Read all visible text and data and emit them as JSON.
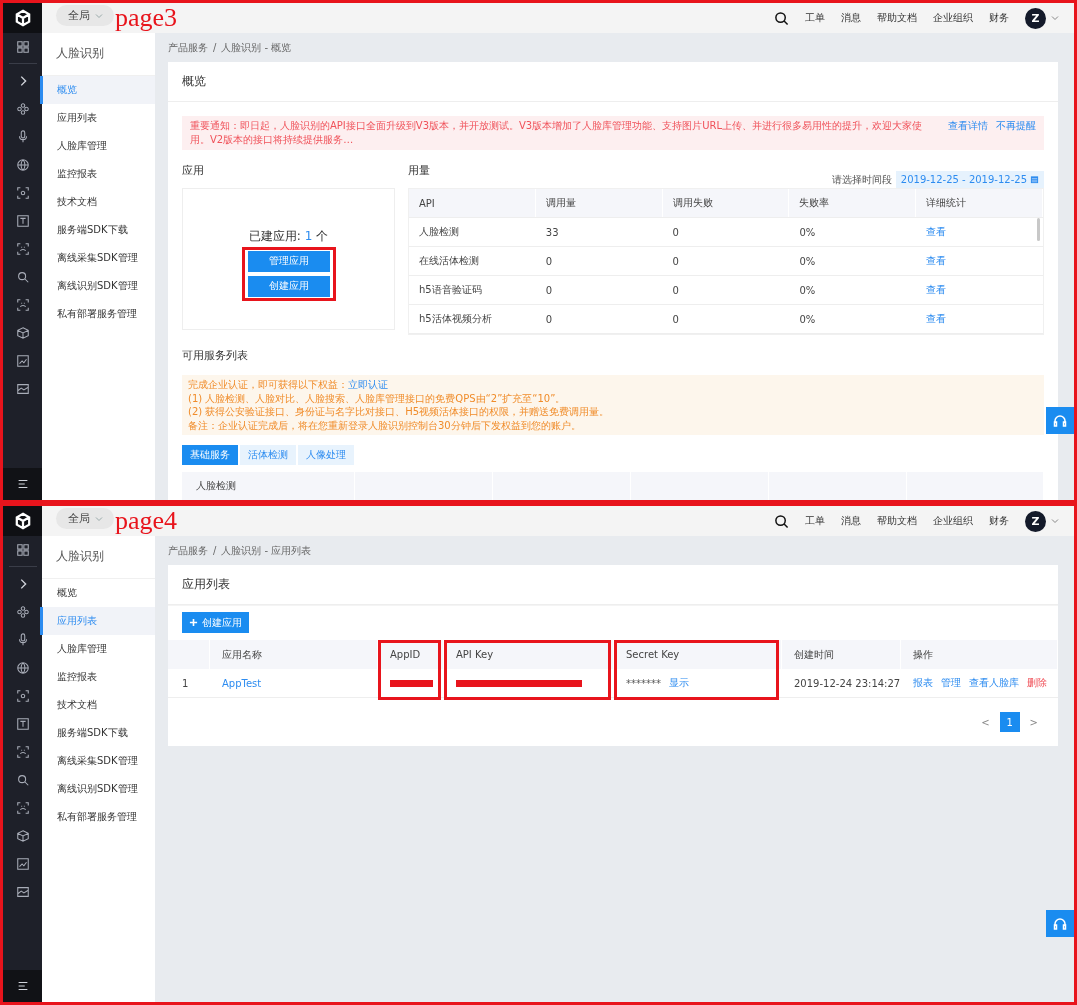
{
  "panes": [
    {
      "annotation": "page3",
      "kind": "overview",
      "topbar": {
        "scope": "全局",
        "links": [
          "工单",
          "消息",
          "帮助文档",
          "企业组织",
          "财务"
        ],
        "avatar": "Z"
      },
      "sidebar": {
        "title": "人脸识别",
        "items": [
          {
            "label": "概览",
            "selected": true
          },
          {
            "label": "应用列表",
            "selected": false
          },
          {
            "label": "人脸库管理",
            "selected": false
          },
          {
            "label": "监控报表",
            "selected": false
          },
          {
            "label": "技术文档",
            "selected": false
          },
          {
            "label": "服务端SDK下载",
            "selected": false
          },
          {
            "label": "离线采集SDK管理",
            "selected": false
          },
          {
            "label": "离线识别SDK管理",
            "selected": false
          },
          {
            "label": "私有部署服务管理",
            "selected": false
          }
        ]
      },
      "breadcrumb": {
        "items": [
          "产品服务",
          "人脸识别 - 概览"
        ],
        "separator": "/"
      },
      "card": {
        "title": "概览",
        "notice": {
          "text": "重要通知：即日起，人脸识别的API接口全面升级到V3版本，并开放测试。V3版本增加了人脸库管理功能、支持图片URL上传、并进行很多易用性的提升，欢迎大家使用。V2版本的接口将持续提供服务…",
          "links": [
            "查看详情",
            "不再提醒"
          ]
        },
        "apps": {
          "title": "应用",
          "label": "已建应用:",
          "count": "1",
          "unit": "个",
          "buttons": [
            "管理应用",
            "创建应用"
          ],
          "annotated": true
        },
        "usage": {
          "title": "用量",
          "date_label": "请选择时间段",
          "date_range": "2019-12-25 - 2019-12-25",
          "columns": [
            "API",
            "调用量",
            "调用失败",
            "失败率",
            "详细统计"
          ],
          "rows": [
            [
              "人脸检测",
              "33",
              "0",
              "0%",
              "查看"
            ],
            [
              "在线活体检测",
              "0",
              "0",
              "0%",
              "查看"
            ],
            [
              "h5语音验证码",
              "0",
              "0",
              "0%",
              "查看"
            ],
            [
              "h5活体视频分析",
              "0",
              "0",
              "0%",
              "查看"
            ]
          ]
        },
        "services": {
          "title": "可用服务列表",
          "banner": {
            "lead": "完成企业认证，即可获得以下权益：",
            "link": "立即认证",
            "lines": [
              "(1) 人脸检测、人脸对比、人脸搜索、人脸库管理接口的免费QPS由“2”扩充至“10”。",
              "(2) 获得公安验证接口、身份证与名字比对接口、H5视频活体接口的权限，并赠送免费调用量。",
              "备注：企业认证完成后，将在您重新登录人脸识别控制台30分钟后下发权益到您的账户。"
            ]
          },
          "tabs": [
            {
              "label": "基础服务",
              "selected": true
            },
            {
              "label": "活体检测",
              "selected": false
            },
            {
              "label": "人像处理",
              "selected": false
            }
          ],
          "table_header": "人脸检测"
        }
      }
    },
    {
      "annotation": "page4",
      "kind": "app_list",
      "topbar": {
        "scope": "全局",
        "links": [
          "工单",
          "消息",
          "帮助文档",
          "企业组织",
          "财务"
        ],
        "avatar": "Z"
      },
      "sidebar": {
        "title": "人脸识别",
        "items": [
          {
            "label": "概览",
            "selected": false
          },
          {
            "label": "应用列表",
            "selected": true
          },
          {
            "label": "人脸库管理",
            "selected": false
          },
          {
            "label": "监控报表",
            "selected": false
          },
          {
            "label": "技术文档",
            "selected": false
          },
          {
            "label": "服务端SDK下载",
            "selected": false
          },
          {
            "label": "离线采集SDK管理",
            "selected": false
          },
          {
            "label": "离线识别SDK管理",
            "selected": false
          },
          {
            "label": "私有部署服务管理",
            "selected": false
          }
        ]
      },
      "breadcrumb": {
        "items": [
          "产品服务",
          "人脸识别 - 应用列表"
        ],
        "separator": "/"
      },
      "card": {
        "title": "应用列表",
        "create_button": "创建应用",
        "columns": [
          {},
          {
            "label": "应用名称"
          },
          {
            "label": "AppID",
            "annotated": true
          },
          {
            "label": "API Key",
            "annotated": true
          },
          {
            "label": "Secret Key",
            "annotated": true
          },
          {
            "label": "创建时间"
          },
          {
            "label": "操作"
          }
        ],
        "rows": [
          [
            {
              "kind": "text",
              "text": "1"
            },
            {
              "kind": "link",
              "text": "AppTest"
            },
            {
              "kind": "redacted"
            },
            {
              "kind": "redacted"
            },
            {
              "kind": "secret",
              "text": "*******",
              "action": "显示"
            },
            {
              "kind": "text",
              "text": "2019-12-24 23:14:27"
            },
            {
              "kind": "actions",
              "items": [
                {
                  "text": "报表",
                  "kind": "link"
                },
                {
                  "text": "管理",
                  "kind": "link"
                },
                {
                  "text": "查看人脸库",
                  "kind": "link"
                },
                {
                  "text": "删除",
                  "kind": "danger"
                }
              ]
            }
          ]
        ],
        "pagination": {
          "prev": "<",
          "next": ">",
          "pages": [
            {
              "label": "1",
              "selected": true
            }
          ]
        }
      }
    }
  ]
}
